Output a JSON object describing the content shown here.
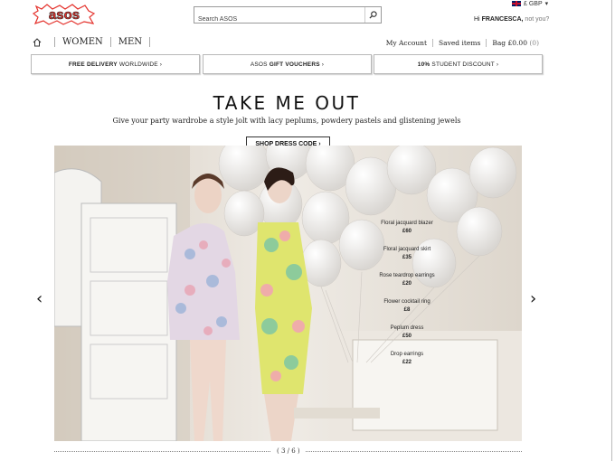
{
  "header": {
    "logo_text": "asos",
    "currency": "£ GBP",
    "search_placeholder": "Search ASOS",
    "greeting_prefix": "Hi",
    "user_name": "FRANCESCA,",
    "not_you": "not you?"
  },
  "nav": {
    "women": "WOMEN",
    "men": "MEN",
    "my_account": "My Account",
    "saved_items": "Saved items",
    "bag": "Bag",
    "bag_total": "£0.00",
    "bag_count": "(0)"
  },
  "promos": {
    "p1_bold": "FREE DELIVERY",
    "p1_rest": " WORLDWIDE ›",
    "p2_pre": "ASOS ",
    "p2_bold": "GIFT VOUCHERS",
    "p2_rest": " ›",
    "p3_bold": "10%",
    "p3_rest": " STUDENT DISCOUNT ›"
  },
  "hero": {
    "title": "TAKE ME OUT",
    "subtitle": "Give your party wardrobe a style jolt with lacy peplums, powdery pastels and glistening jewels",
    "cta": "SHOP DRESS CODE ›",
    "products": [
      {
        "name": "Floral jacquard blazer",
        "price": "£60"
      },
      {
        "name": "Floral jacquard skirt",
        "price": "£35"
      },
      {
        "name": "Rose teardrop earrings",
        "price": "£20"
      },
      {
        "name": "Flower cocktail ring",
        "price": "£8"
      },
      {
        "name": "Peplum dress",
        "price": "£50"
      },
      {
        "name": "Drop earrings",
        "price": "£22"
      }
    ]
  },
  "carousel": {
    "prev": "‹",
    "next": "›",
    "page": "( 3 / 6 )"
  },
  "colors": {
    "logo_red": "#e4312b",
    "logo_fill": "#ffffff"
  }
}
